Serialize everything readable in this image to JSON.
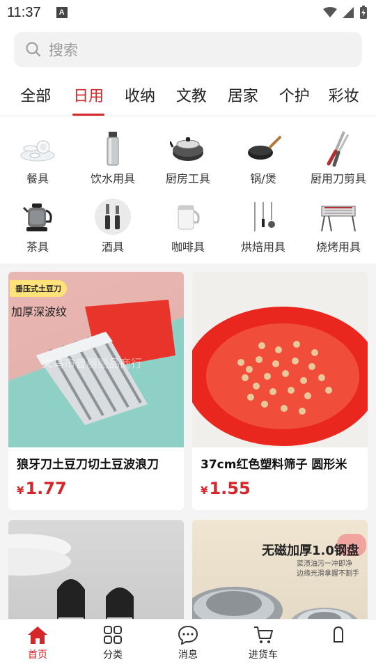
{
  "status_bar": {
    "time": "11:37",
    "notification_badge": "A"
  },
  "search": {
    "placeholder": "搜索"
  },
  "tabs": [
    {
      "label": "全部",
      "active": false
    },
    {
      "label": "日用",
      "active": true
    },
    {
      "label": "收纳",
      "active": false
    },
    {
      "label": "文教",
      "active": false
    },
    {
      "label": "居家",
      "active": false
    },
    {
      "label": "个护",
      "active": false
    },
    {
      "label": "彩妆",
      "active": false
    }
  ],
  "categories": [
    {
      "label": "餐具",
      "icon": "tableware-icon"
    },
    {
      "label": "饮水用具",
      "icon": "water-bottle-icon"
    },
    {
      "label": "厨房工具",
      "icon": "cookware-icon"
    },
    {
      "label": "锅/煲",
      "icon": "wok-icon"
    },
    {
      "label": "厨用刀剪具",
      "icon": "scissors-icon"
    },
    {
      "label": "茶具",
      "icon": "kettle-icon"
    },
    {
      "label": "酒具",
      "icon": "bar-tools-icon"
    },
    {
      "label": "咖啡具",
      "icon": "coffee-mug-icon"
    },
    {
      "label": "烘焙用具",
      "icon": "baking-tools-icon"
    },
    {
      "label": "烧烤用具",
      "icon": "grill-icon"
    }
  ],
  "products": [
    {
      "title": "狼牙刀土豆刀切土豆波浪刀",
      "currency": "¥",
      "price": "1.77",
      "badge_line1": "垂压式土豆刀",
      "badge_line2": "加厚深波纹",
      "watermark": "义乌市曾丽丽品商行"
    },
    {
      "title": "37cm红色塑料筛子 圆形米",
      "currency": "¥",
      "price": "1.55"
    },
    {
      "title": "",
      "currency": "",
      "price": ""
    },
    {
      "title": "",
      "currency": "",
      "price": "",
      "overlay_title": "无磁加厚1.0钢盘",
      "overlay_line1": "菜渍油污一冲即净",
      "overlay_line2": "边缘光滑拿握不割手"
    }
  ],
  "bottom_nav": [
    {
      "label": "首页",
      "active": true,
      "icon": "home-icon"
    },
    {
      "label": "分类",
      "active": false,
      "icon": "grid-icon"
    },
    {
      "label": "消息",
      "active": false,
      "icon": "message-icon"
    },
    {
      "label": "进货车",
      "active": false,
      "icon": "cart-icon"
    },
    {
      "label": "",
      "active": false,
      "icon": "profile-icon"
    }
  ],
  "colors": {
    "accent": "#d5262b"
  }
}
